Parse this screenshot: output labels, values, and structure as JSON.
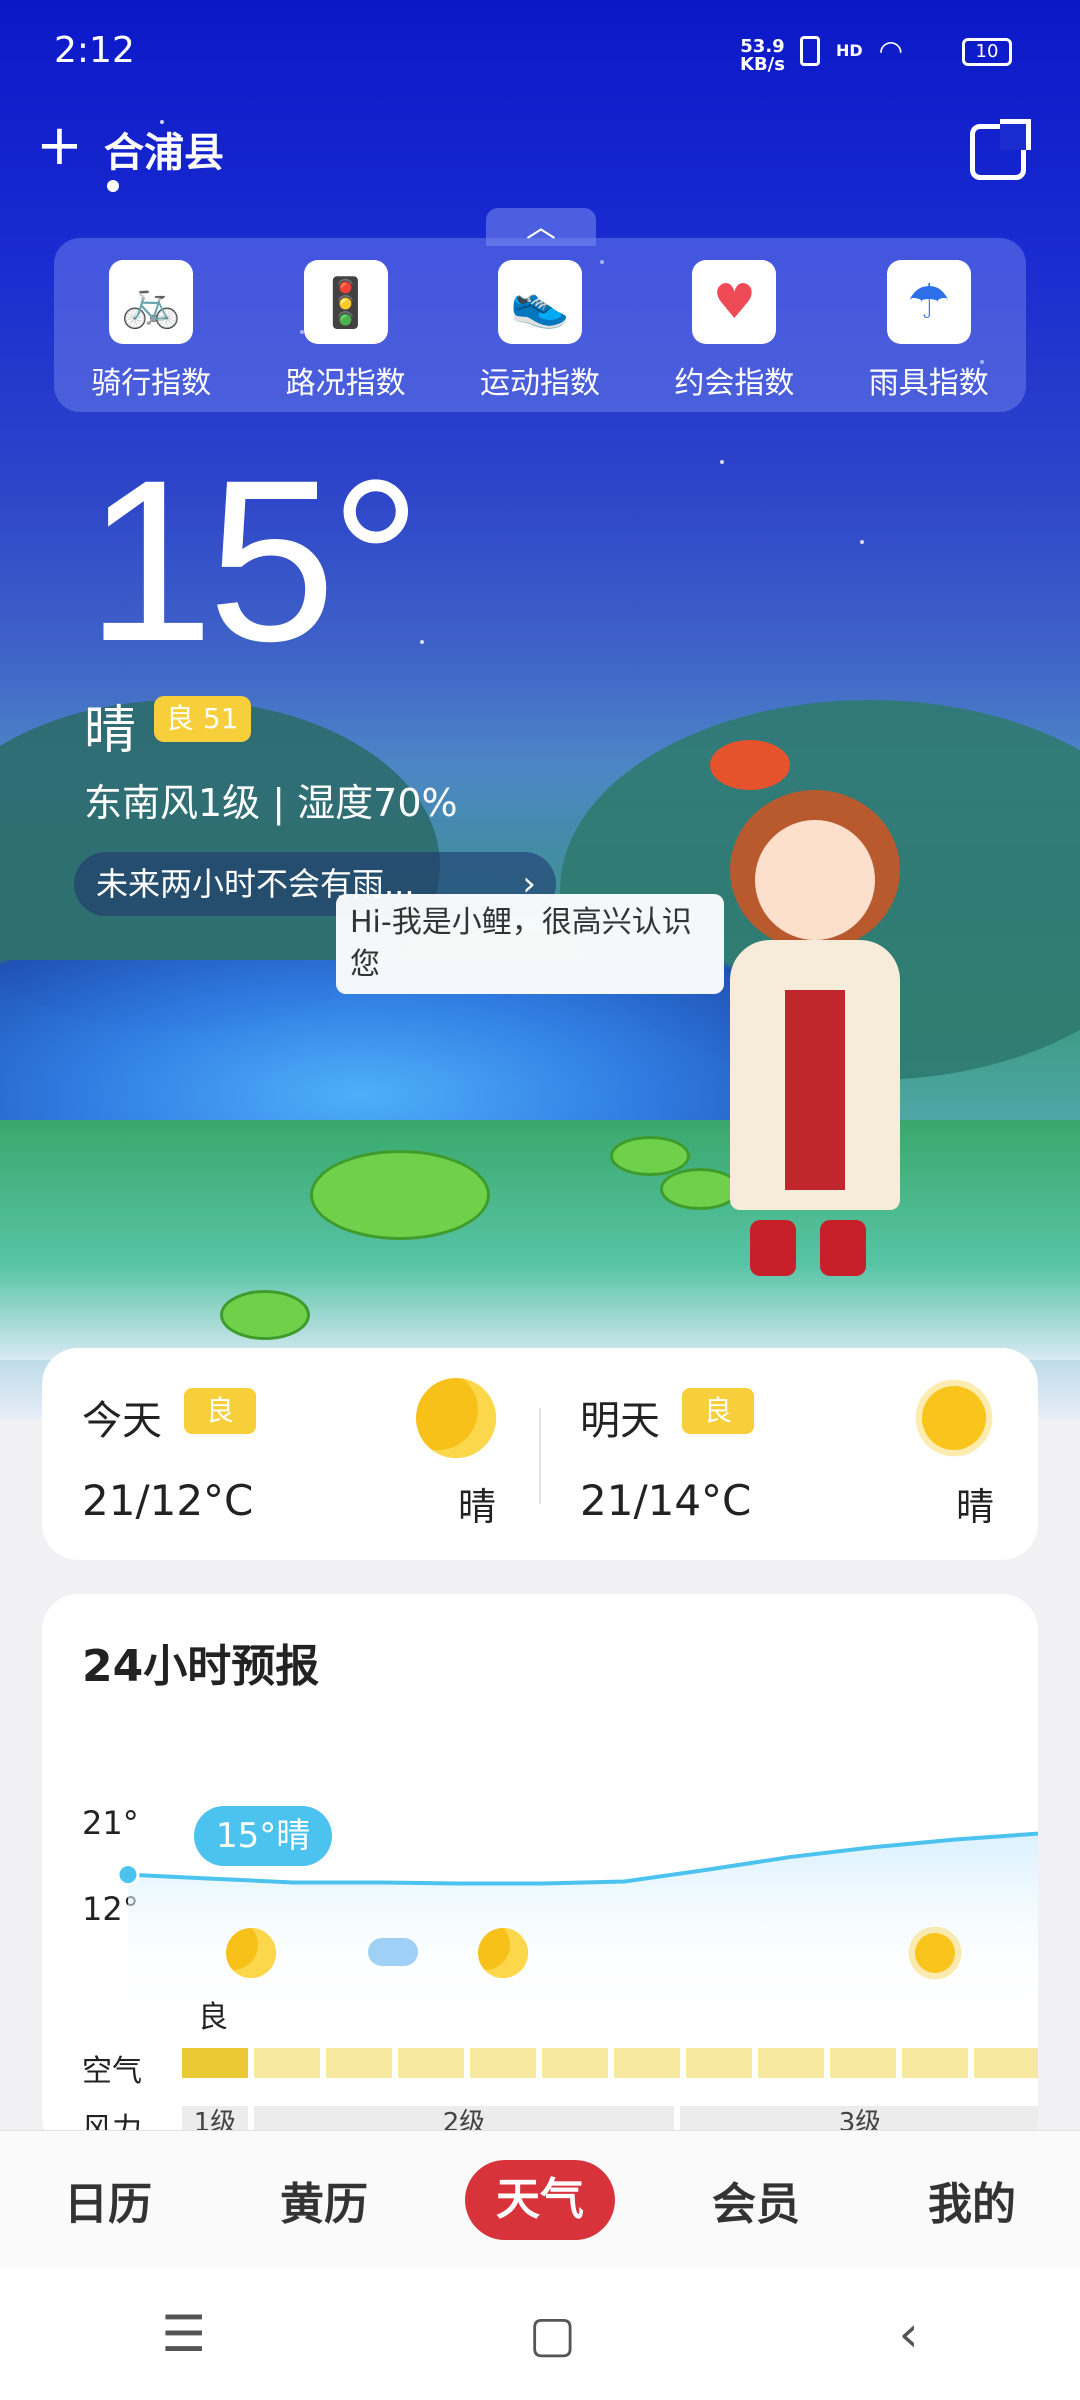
{
  "status_bar": {
    "time": "2:12",
    "speed": "53.9",
    "speed_unit": "KB/s",
    "network": "HD",
    "battery": "10"
  },
  "header": {
    "city": "合浦县"
  },
  "indices": [
    {
      "label": "骑行指数",
      "icon": "bicycle-icon"
    },
    {
      "label": "路况指数",
      "icon": "traffic-light-icon"
    },
    {
      "label": "运动指数",
      "icon": "running-shoe-icon"
    },
    {
      "label": "约会指数",
      "icon": "hearts-icon"
    },
    {
      "label": "雨具指数",
      "icon": "umbrella-icon"
    }
  ],
  "current": {
    "temperature": "15°",
    "condition": "晴",
    "aqi_badge": "良 51",
    "wind_humidity": "东南风1级 | 湿度70%",
    "rain_hint": "未来两小时不会有雨...",
    "mascot_bubble": "Hi-我是小鲤，很高兴认识您"
  },
  "days": [
    {
      "name": "今天",
      "aqi": "良",
      "range": "21/12°C",
      "weather": "晴",
      "icon": "moon-icon"
    },
    {
      "name": "明天",
      "aqi": "良",
      "range": "21/14°C",
      "weather": "晴",
      "icon": "sun-icon"
    }
  ],
  "hourly": {
    "title": "24小时预报",
    "y_max": "21°",
    "y_min": "12°",
    "tooltip": "15°晴",
    "aqi_label": "良",
    "row_air": "空气",
    "row_wind": "风力",
    "wind_levels": [
      "1级",
      "2级",
      "3级"
    ]
  },
  "chart_data": {
    "type": "line",
    "ylim": [
      12,
      21
    ],
    "series": [
      {
        "values": [
          15,
          14.6,
          14.2,
          14.2,
          14.1,
          14.1,
          14.3,
          15.5,
          16.8,
          17.8,
          18.6,
          19.2
        ]
      }
    ]
  },
  "nav": {
    "items": [
      "日历",
      "黄历",
      "天气",
      "会员",
      "我的"
    ],
    "active": 2
  },
  "colors": {
    "accent": "#d8323b",
    "aqi": "#f6cf3a",
    "tooltip": "#4cc3ef"
  }
}
